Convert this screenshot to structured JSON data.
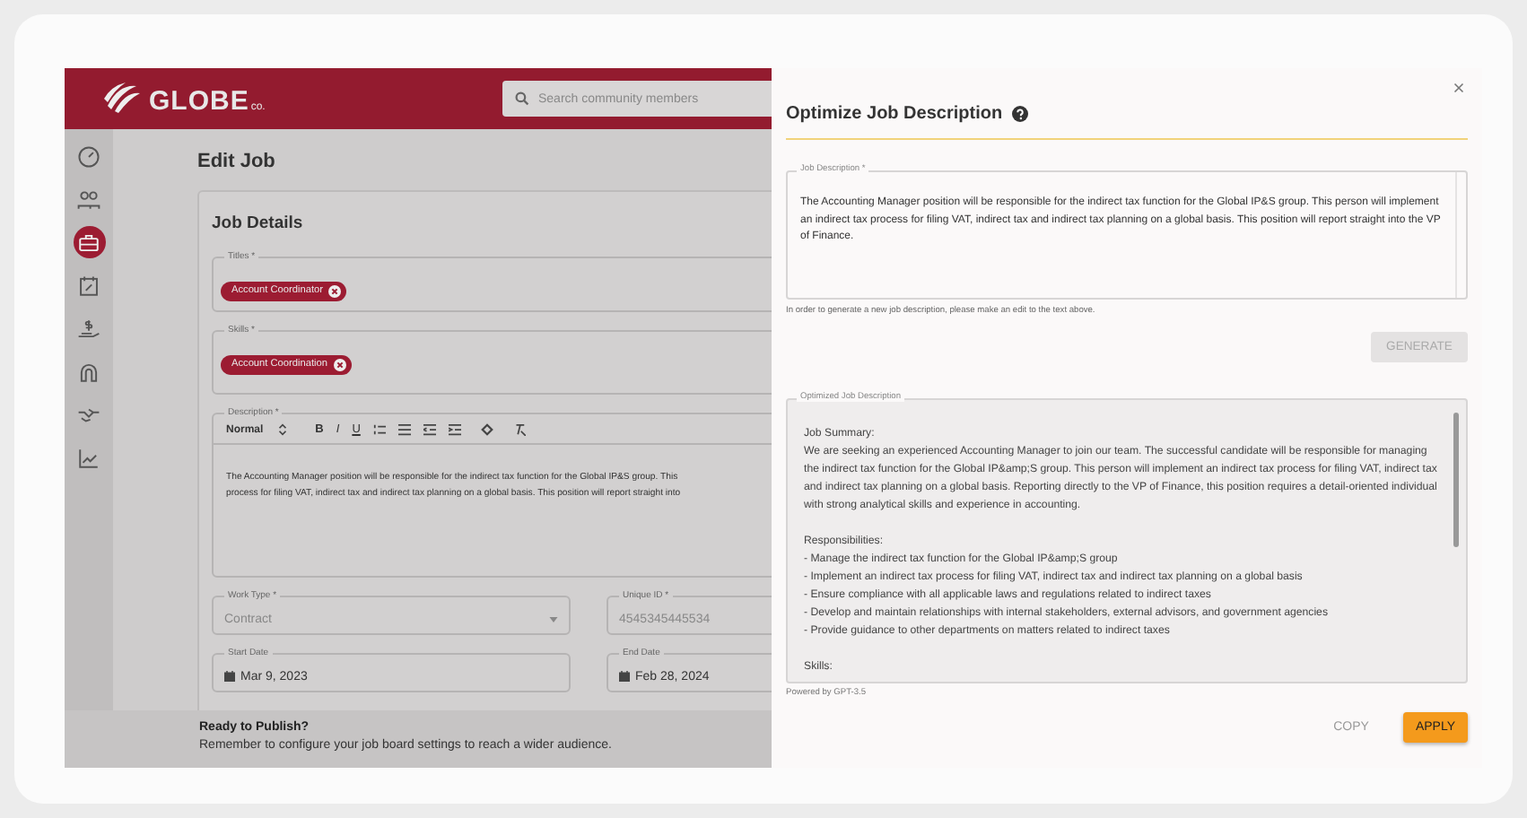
{
  "header": {
    "logo": "GLOBE",
    "logo_suffix": "co.",
    "search": {
      "placeholder": "Search community members"
    }
  },
  "sidebar": {
    "items": [
      {
        "selected": false
      },
      {
        "selected": false
      },
      {
        "selected": true
      },
      {
        "selected": false
      },
      {
        "selected": false
      },
      {
        "selected": false
      },
      {
        "selected": false
      },
      {
        "selected": false
      }
    ]
  },
  "page": {
    "title": "Edit Job",
    "card_title": "Job Details",
    "titles": {
      "label": "Titles *",
      "chips": [
        "Account Coordinator"
      ]
    },
    "skills": {
      "label": "Skills *",
      "chips": [
        "Account Coordination"
      ]
    },
    "description": {
      "label": "Description *",
      "format": "Normal",
      "tools": [
        "B",
        "I",
        "U"
      ],
      "lines": [
        "The Accounting Manager position will be responsible for the indirect tax function for the Global IP&S group. This",
        "process for filing VAT, indirect tax and indirect tax planning on a global basis. This position will report straight into"
      ]
    },
    "work_type": {
      "label": "Work Type *",
      "value": "Contract",
      "disabled": true
    },
    "unique_id": {
      "label": "Unique ID *",
      "value": "4545345445534",
      "disabled": true
    },
    "start_date": {
      "label": "Start Date",
      "value": "Mar 9, 2023"
    },
    "end_date": {
      "label": "End Date",
      "value": "Feb 28, 2024"
    }
  },
  "publish_bar": {
    "title": "Ready to Publish?",
    "text": "Remember to configure your job board settings to reach a wider audience."
  },
  "drawer": {
    "title": "Optimize Job Description",
    "job_description": {
      "label": "Job Description *",
      "value": "The Accounting Manager position will be responsible for the indirect tax function for the Global IP&S group. This person will implement an indirect tax process for filing VAT, indirect tax and indirect tax planning on a global basis. This position will report straight into the VP of Finance."
    },
    "hint": "In order to generate a new job description, please make an edit to the text above.",
    "generate": {
      "label": "GENERATE",
      "disabled": true
    },
    "optimized": {
      "label": "Optimized Job Description",
      "sections": [
        {
          "heading": "Job Summary:",
          "lines": [
            "We are seeking an experienced Accounting Manager to join our team. The successful candidate will be responsible for managing the indirect tax function for the Global IP&amp;S group. This person will implement an indirect tax process for filing VAT, indirect tax and indirect tax planning on a global basis. Reporting directly to the VP of Finance, this position requires a detail-oriented individual with strong analytical skills and experience in accounting."
          ]
        },
        {
          "heading": "Responsibilities:",
          "lines": [
            "- Manage the indirect tax function for the Global IP&amp;S group",
            "- Implement an indirect tax process for filing VAT, indirect tax and indirect tax planning on a global basis",
            "- Ensure compliance with all applicable laws and regulations related to indirect taxes",
            "- Develop and maintain relationships with internal stakeholders, external advisors, and government agencies",
            "- Provide guidance to other departments on matters related to indirect taxes"
          ]
        },
        {
          "heading": "Skills:"
        }
      ]
    },
    "powered_by": "Powered by GPT-3.5",
    "actions": [
      {
        "label": "COPY",
        "kind": "text"
      },
      {
        "label": "APPLY",
        "kind": "contained"
      }
    ]
  }
}
